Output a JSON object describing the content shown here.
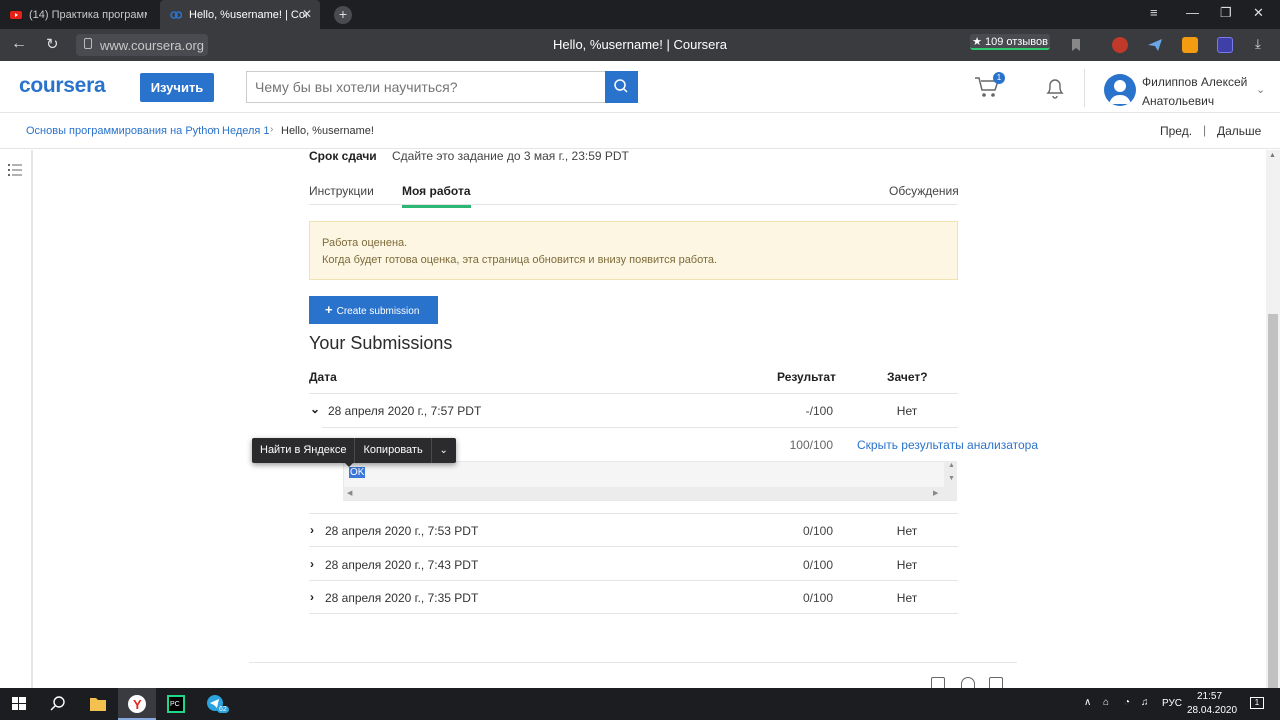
{
  "browser": {
    "tabs": [
      {
        "title": "(14) Практика программи",
        "icon": "youtube-icon",
        "active": false
      },
      {
        "title": "Hello, %username! | Cou",
        "icon": "coursera-icon",
        "active": true
      }
    ],
    "url": "www.coursera.org",
    "page_title": "Hello, %username! | Coursera",
    "reviews_badge": "★ 109 отзывов"
  },
  "header": {
    "logo": "coursera",
    "learn_button": "Изучить",
    "search_placeholder": "Чему бы вы хотели научиться?",
    "cart_count": "1",
    "user_name": "Филиппов Алексей Анатольевич"
  },
  "breadcrumb": {
    "items": [
      "Основы программирования на Python",
      "Неделя 1",
      "Hello, %username!"
    ],
    "prev": "Пред.",
    "separator": "|",
    "next": "Дальше"
  },
  "assignment": {
    "deadline_label": "Срок сдачи",
    "deadline_text": "Сдайте это задание до 3 мая г., 23:59 PDT",
    "tabs": [
      {
        "label": "Инструкции",
        "active": false
      },
      {
        "label": "Моя работа",
        "active": true
      },
      {
        "label": "Обсуждения",
        "active": false
      }
    ],
    "notice_line1": "Работа оценена.",
    "notice_line2": "Когда будет готова оценка, эта страница обновится и внизу появится работа.",
    "create_button": "Create submission",
    "submissions_title": "Your Submissions"
  },
  "submissions_table": {
    "columns": [
      "Дата",
      "Результат",
      "Зачет?"
    ],
    "rows": [
      {
        "date": "28 апреля 2020 г., 7:57 PDT",
        "score": "-/100",
        "passed": "Нет",
        "expanded": true
      },
      {
        "date": "28 апреля 2020 г., 7:53 PDT",
        "score": "0/100",
        "passed": "Нет",
        "expanded": false
      },
      {
        "date": "28 апреля 2020 г., 7:43 PDT",
        "score": "0/100",
        "passed": "Нет",
        "expanded": false
      },
      {
        "date": "28 апреля 2020 г., 7:35 PDT",
        "score": "0/100",
        "passed": "Нет",
        "expanded": false
      }
    ],
    "analyzer": {
      "score": "100/100",
      "hide_link": "Скрыть результаты анализатора",
      "output": "OK"
    }
  },
  "context_menu": {
    "search_yandex": "Найти в Яндексе",
    "copy": "Копировать"
  },
  "taskbar": {
    "tray_lang": "РУС",
    "time": "21:57",
    "date": "28.04.2020",
    "telegram_badge": "62",
    "notifications_count": "1"
  },
  "colors": {
    "brand_blue": "#2a73cc",
    "tab_active_underline": "#2bb673",
    "notice_bg": "#fdf6e2"
  }
}
